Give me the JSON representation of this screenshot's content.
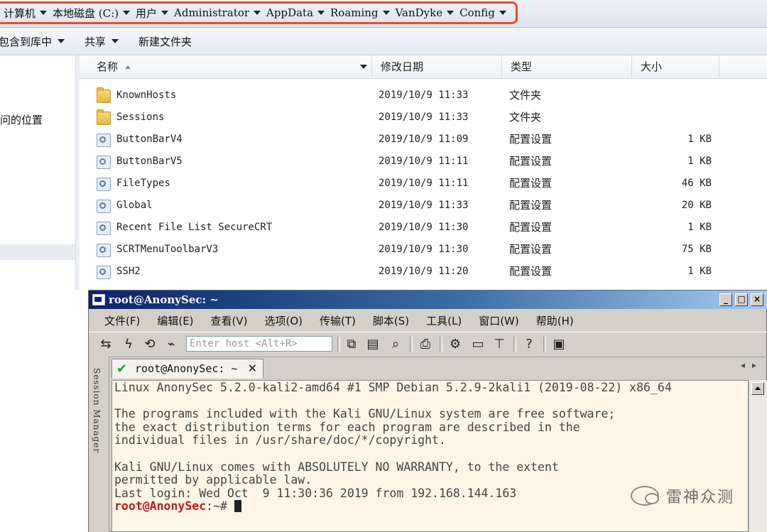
{
  "explorer": {
    "breadcrumb": [
      "计算机",
      "本地磁盘 (C:)",
      "用户",
      "Administrator",
      "AppData",
      "Roaming",
      "VanDyke",
      "Config"
    ],
    "toolbar": {
      "include_library": "包含到库中",
      "share": "共享",
      "new_folder": "新建文件夹"
    },
    "nav_location_text": "问的位置",
    "columns": {
      "name": "名称",
      "date": "修改日期",
      "type": "类型",
      "size": "大小"
    },
    "files": [
      {
        "name": "KnownHosts",
        "date": "2019/10/9 11:33",
        "type": "文件夹",
        "size": "",
        "icon": "folder-icon"
      },
      {
        "name": "Sessions",
        "date": "2019/10/9 11:33",
        "type": "文件夹",
        "size": "",
        "icon": "folder-icon"
      },
      {
        "name": "ButtonBarV4",
        "date": "2019/10/9 11:09",
        "type": "配置设置",
        "size": "1 KB",
        "icon": "config-file-icon"
      },
      {
        "name": "ButtonBarV5",
        "date": "2019/10/9 11:11",
        "type": "配置设置",
        "size": "1 KB",
        "icon": "config-file-icon"
      },
      {
        "name": "FileTypes",
        "date": "2019/10/9 11:11",
        "type": "配置设置",
        "size": "46 KB",
        "icon": "config-file-icon"
      },
      {
        "name": "Global",
        "date": "2019/10/9 11:33",
        "type": "配置设置",
        "size": "20 KB",
        "icon": "config-file-icon"
      },
      {
        "name": "Recent File List SecureCRT",
        "date": "2019/10/9 11:30",
        "type": "配置设置",
        "size": "1 KB",
        "icon": "config-file-icon"
      },
      {
        "name": "SCRTMenuToolbarV3",
        "date": "2019/10/9 11:30",
        "type": "配置设置",
        "size": "75 KB",
        "icon": "config-file-icon"
      },
      {
        "name": "SSH2",
        "date": "2019/10/9 11:20",
        "type": "配置设置",
        "size": "1 KB",
        "icon": "config-file-icon"
      }
    ]
  },
  "crt": {
    "title": "root@AnonySec: ~",
    "menu": [
      "文件(F)",
      "编辑(E)",
      "查看(V)",
      "选项(O)",
      "传输(T)",
      "脚本(S)",
      "工具(L)",
      "窗口(W)",
      "帮助(H)"
    ],
    "host_placeholder": "Enter host <Alt+R>",
    "session_manager": "Session Manager",
    "tab_label": "root@AnonySec: ~",
    "terminal_lines": [
      "Linux AnonySec 5.2.0-kali2-amd64 #1 SMP Debian 5.2.9-2kali1 (2019-08-22) x86_64",
      "",
      "The programs included with the Kali GNU/Linux system are free software;",
      "the exact distribution terms for each program are described in the",
      "individual files in /usr/share/doc/*/copyright.",
      "",
      "Kali GNU/Linux comes with ABSOLUTELY NO WARRANTY, to the extent",
      "permitted by applicable law.",
      "Last login: Wed Oct  9 11:30:36 2019 from 192.168.144.163"
    ],
    "prompt_user": "root@AnonySec",
    "prompt_suffix": ":~# "
  },
  "watermark": "雷神众测",
  "colors": {
    "highlight": "#ef4a2a",
    "prompt": "#c41a1a",
    "terminal_bg": "#fdf6e6"
  }
}
